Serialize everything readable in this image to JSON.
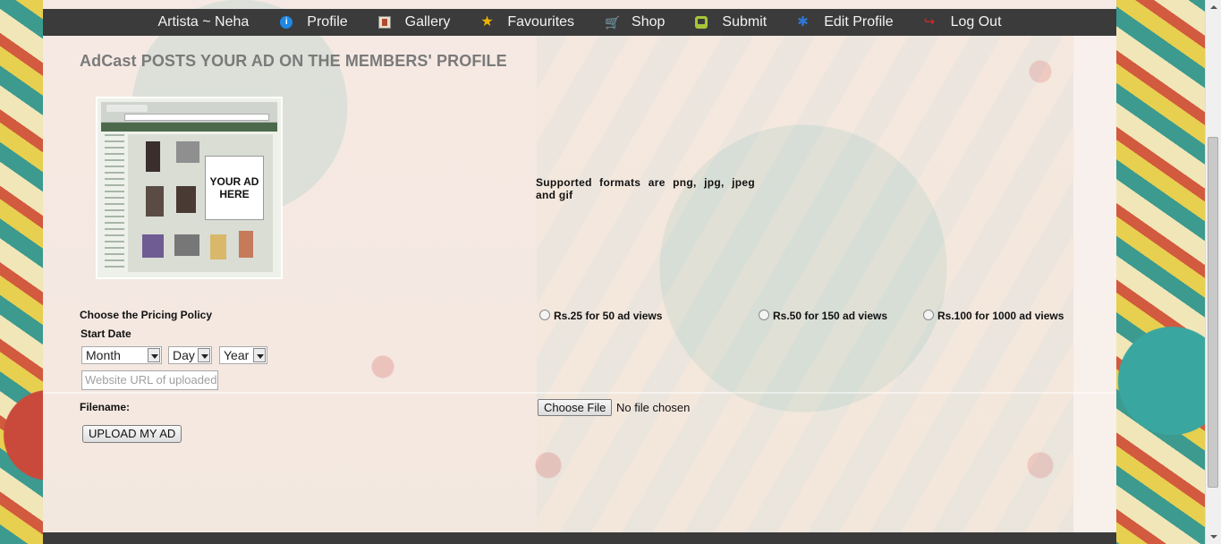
{
  "nav": {
    "brand": "Artista ~ Neha",
    "items": [
      {
        "label": "Profile",
        "icon": "info-icon"
      },
      {
        "label": "Gallery",
        "icon": "gallery-icon"
      },
      {
        "label": "Favourites",
        "icon": "star-icon"
      },
      {
        "label": "Shop",
        "icon": "shop-cart-icon"
      },
      {
        "label": "Submit",
        "icon": "submit-icon"
      },
      {
        "label": "Edit Profile",
        "icon": "gear-icon"
      },
      {
        "label": "Log Out",
        "icon": "logout-icon"
      }
    ]
  },
  "page": {
    "title": "AdCast POSTS YOUR AD ON THE MEMBERS' PROFILE",
    "ad_preview_text": "YOUR AD HERE",
    "supported_formats": "Supported formats are png, jpg, jpeg and gif"
  },
  "form": {
    "pricing_label": "Choose the Pricing Policy",
    "pricing_options": [
      "Rs.25 for 50 ad views",
      "Rs.50 for 150 ad views",
      "Rs.100 for 1000 ad views"
    ],
    "start_date_label": "Start Date",
    "month_value": "Month",
    "day_value": "Day",
    "year_value": "Year",
    "url_placeholder": "Website URL of uploaded",
    "filename_label": "Filename:",
    "choose_file_label": "Choose File",
    "file_status": "No file chosen",
    "upload_label": "UPLOAD MY AD"
  }
}
